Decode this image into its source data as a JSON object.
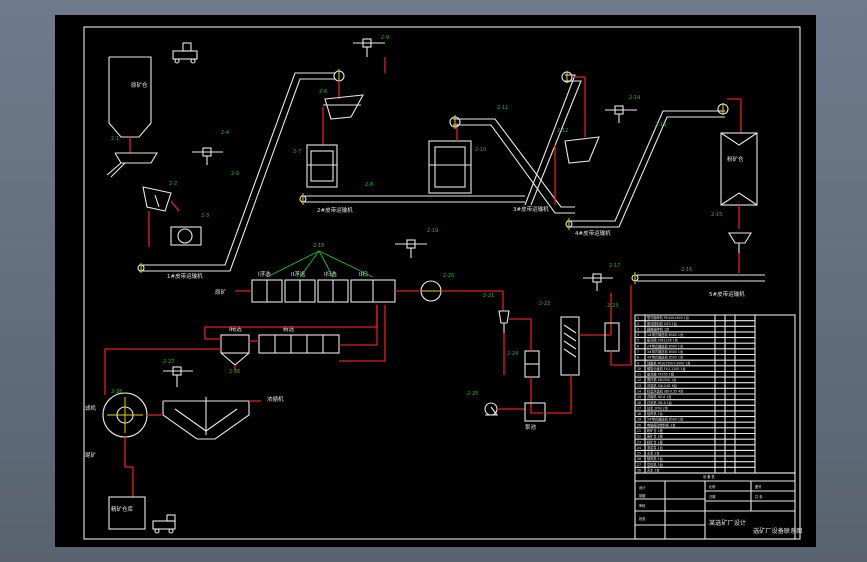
{
  "drawing": {
    "labels": {
      "ore_bin": "原矿仓",
      "powder_bin": "粉矿仓",
      "flotation_1": "I浮选",
      "flotation_2": "II浮选",
      "flotation_3": "I扫选",
      "flotation_4": "II扫",
      "concentrate_tank": "I精选",
      "conc_stage": "精选",
      "thickener_label": "浓缩机",
      "filter_label": "滤机",
      "tank_label": "泵池",
      "feed_label": "原矿",
      "tailings_label": "尾矿",
      "product_bin": "精矿仓库",
      "belt_1": "1#皮带运输机",
      "belt_2": "2#皮带运输机",
      "belt_3": "3#皮带运输机",
      "belt_4": "4#皮带运输机",
      "belt_5": "5#皮带运输机"
    },
    "tags": [
      "2-1",
      "2-2",
      "2-3",
      "2-4",
      "2-5",
      "2-6",
      "2-7",
      "2-8",
      "2-9",
      "2-10",
      "2-11",
      "2-12",
      "2-13",
      "2-14",
      "2-15",
      "2-16",
      "2-17",
      "2-18",
      "2-19",
      "2-20",
      "2-21",
      "2-22",
      "2-23",
      "2-24",
      "2-25",
      "2-26",
      "2-27",
      "2-28"
    ]
  },
  "title_block": {
    "list_header": "设 备 表",
    "rows": [
      "颚式破碎机 PE400×600 1台",
      "振动给料机 GZ3 1台",
      "圆锥破碎机 1台",
      "1#带式输送机 B500 1台",
      "振动筛 2YA1236 1台",
      "2#带式输送机 B500 1台",
      "3#带式输送机 B500 1台",
      "4#带式输送机 B500 1台",
      "球磨机 MQG1500×3000 1台",
      "螺旋分级机 FLG-1200 1台",
      "旋流器 FX250 1组",
      "搅拌槽 XB1500 1台",
      "浮选机 XJK-0.62 8台",
      "精选浮选机 XJK-0.35 4台",
      "浓缩机 NZ-6 1台",
      "过滤机 GN-8 1台",
      "砂泵 2PNJ 2台",
      "给药机 1台",
      "5#带式输送机 B500 1台",
      "电磁振动给料机 2台",
      "粉矿仓 1座",
      "原矿仓 1座",
      "精矿仓 1座",
      "渣浆泵 1台",
      "水泵 2台",
      "鼓风机 1台",
      "空压机 1台",
      "天车 1台"
    ],
    "project": "某选矿厂设计",
    "drawing_name": "选矿厂设备联系图",
    "fields": [
      "设计",
      "制图",
      "审核",
      "批准",
      "比例",
      "图号",
      "日期",
      "共 张"
    ]
  }
}
